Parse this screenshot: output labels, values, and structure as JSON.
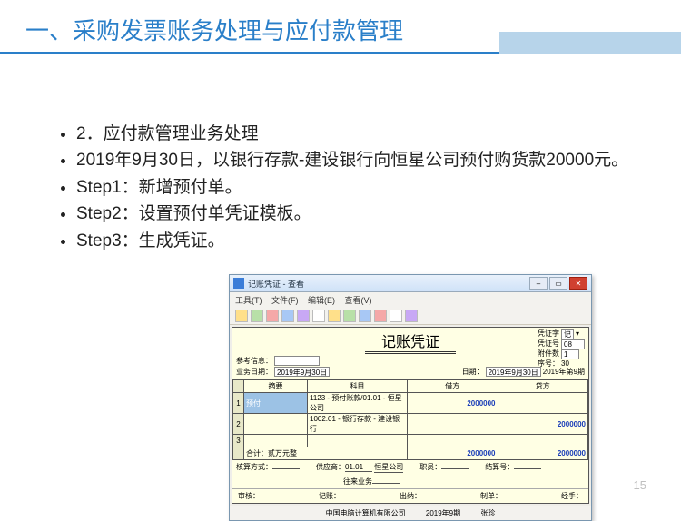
{
  "slide": {
    "title": "一、采购发票账务处理与应付款管理",
    "bullets": [
      "2．应付款管理业务处理",
      "2019年9月30日，以银行存款-建设银行向恒星公司预付购货款20000元。",
      "Step1：新增预付单。",
      "Step2：设置预付单凭证模板。",
      "Step3：生成凭证。"
    ],
    "page_number": "15"
  },
  "voucher_window": {
    "title": "记账凭证 - 查看",
    "menu": [
      "工具(T)",
      "文件(F)",
      "编辑(E)",
      "查看(V)"
    ],
    "body_title": "记账凭证",
    "right_meta": {
      "pzz_label": "凭证字",
      "pzz_value": "记",
      "pzh_label": "凭证号",
      "pzh_value": "08",
      "fj_label": "附件数",
      "fj_value": "1",
      "xh_label": "序号：",
      "xh_value": "30"
    },
    "left_meta": {
      "ref_label": "参考信息：",
      "date_label": "业务日期：",
      "date_value": "2019年9月30日",
      "rq_label": "日期：",
      "rq_value": "2019年9月30日",
      "period_value": "2019年第9期"
    },
    "columns": [
      "摘要",
      "科目",
      "借方",
      "贷方"
    ],
    "rows": [
      {
        "idx": "1",
        "summary": "预付",
        "subject": "1123 - 预付账款/01.01 - 恒星公司",
        "debit": "2000000",
        "credit": ""
      },
      {
        "idx": "2",
        "summary": "",
        "subject": "1002.01 - 银行存款 - 建设银行",
        "debit": "",
        "credit": "2000000"
      },
      {
        "idx": "3",
        "summary": "",
        "subject": "",
        "debit": "",
        "credit": ""
      }
    ],
    "total": {
      "label": "合计：贰万元整",
      "debit": "2000000",
      "credit": "2000000"
    },
    "bottom": {
      "jsfs_label": "核算方式：",
      "jsh_label": "结算号：",
      "gys_label": "供应商：",
      "gys_val1": "01.01",
      "gys_val2": "恒星公司",
      "zy_label": "职员：",
      "wl_label": "往来业务"
    },
    "foot": {
      "shr": "审核：",
      "gz": "记账：",
      "cn": "出纳：",
      "zd": "制单：",
      "jbr": "经手："
    },
    "status": {
      "company": "中国电脑计算机有限公司",
      "period": "2019年9期",
      "user": "张珍"
    }
  }
}
